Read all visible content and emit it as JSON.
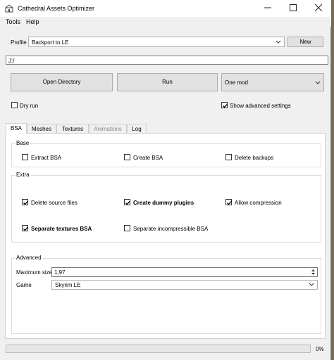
{
  "window": {
    "title": "Cathedral Assets Optimizer"
  },
  "menu": {
    "tools": "Tools",
    "help": "Help"
  },
  "profile": {
    "label": "Profile",
    "value": "Backport to LE",
    "new_button": "New"
  },
  "path": {
    "value": "J:/"
  },
  "actions": {
    "open_directory": "Open Directory",
    "run": "Run",
    "mode": "One mod"
  },
  "options": {
    "dry_run": "Dry run",
    "dry_run_checked": false,
    "show_advanced": "Show advanced settings",
    "show_advanced_checked": true
  },
  "tabs": [
    {
      "label": "BSA",
      "active": true,
      "disabled": false
    },
    {
      "label": "Meshes",
      "active": false,
      "disabled": false
    },
    {
      "label": "Textures",
      "active": false,
      "disabled": false
    },
    {
      "label": "Animations",
      "active": false,
      "disabled": true
    },
    {
      "label": "Log",
      "active": false,
      "disabled": false
    }
  ],
  "base": {
    "title": "Base",
    "extract_bsa": "Extract BSA",
    "extract_bsa_checked": false,
    "create_bsa": "Create BSA",
    "create_bsa_checked": false,
    "delete_backups": "Delete backups",
    "delete_backups_checked": false
  },
  "extra": {
    "title": "Extra",
    "delete_source": "Delete source files",
    "delete_source_checked": true,
    "create_dummy": "Create dummy plugins",
    "create_dummy_checked": true,
    "allow_compression": "Allow compression",
    "allow_compression_checked": true,
    "separate_textures": "Separate textures BSA",
    "separate_textures_checked": true,
    "separate_incompressible": "Separate incompressible BSA",
    "separate_incompressible_checked": false
  },
  "advanced": {
    "title": "Advanced",
    "max_size_label": "Maximum size",
    "max_size_value": "1,97",
    "game_label": "Game",
    "game_value": "Skyrim LE"
  },
  "progress": {
    "percent": 0,
    "label": "0%"
  },
  "colors": {
    "accent": "#0078d7",
    "window_bg": "#f0f0f0",
    "panel_bg": "#ffffff"
  }
}
